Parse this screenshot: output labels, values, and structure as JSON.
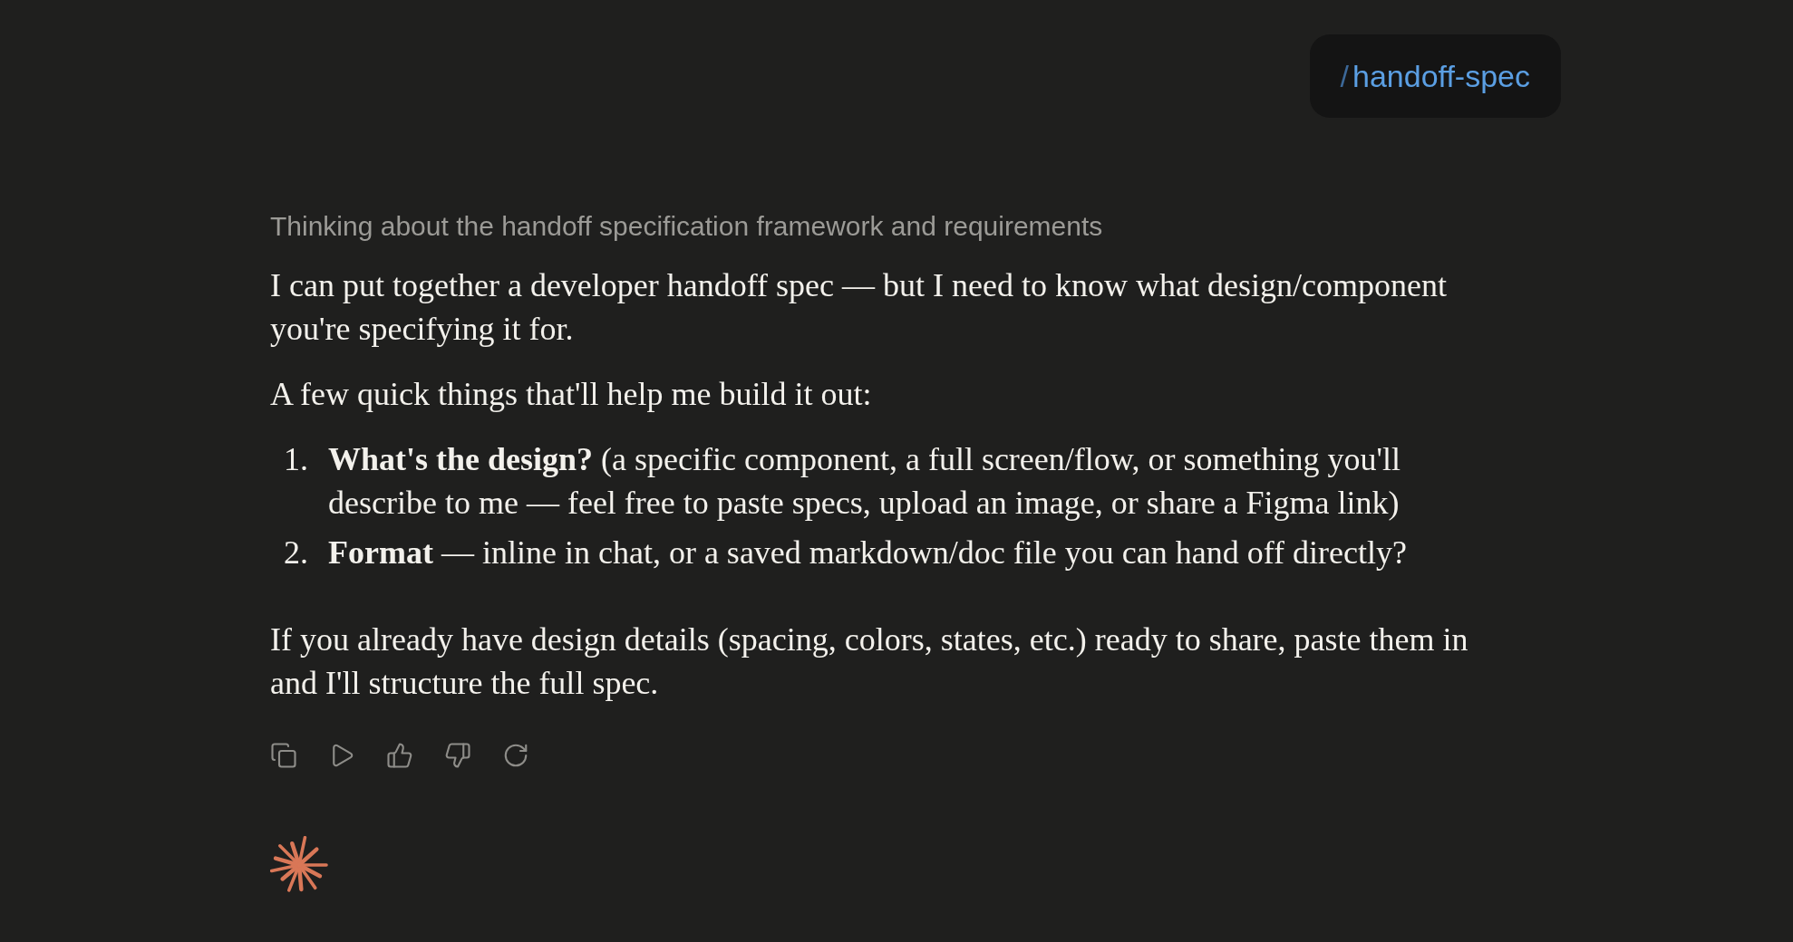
{
  "user_message": {
    "command_prefix": "/",
    "command": "handoff-spec"
  },
  "response": {
    "thinking_summary": "Thinking about the handoff specification framework and requirements",
    "blocks": [
      {
        "kind": "paragraph",
        "text": "I can put together a developer handoff spec — but I need to know what design/component you're specifying it for."
      },
      {
        "kind": "paragraph",
        "text": "A few quick things that'll help me build it out:"
      },
      {
        "kind": "list",
        "items": [
          {
            "marker": "1.",
            "text": "**What's the design?** (a specific component, a full screen/flow, or something you'll describe to me — feel free to paste specs, upload an image, or share a Figma link)"
          },
          {
            "marker": "2.",
            "text": "**Format** — inline in chat, or a saved markdown/doc file you can hand off directly?"
          }
        ]
      },
      {
        "kind": "paragraph",
        "text": "If you already have design details (spacing, colors, states, etc.) ready to share, paste them in and I'll structure the full spec."
      }
    ]
  }
}
